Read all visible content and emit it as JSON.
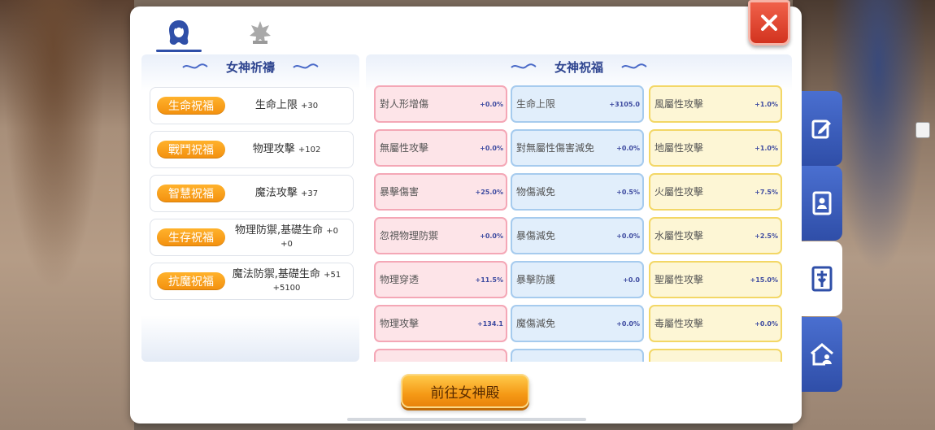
{
  "tabs": [
    {
      "icon": "goddess-head-icon",
      "active": true
    },
    {
      "icon": "crystal-emblem-icon",
      "active": false
    }
  ],
  "left": {
    "header": "女神祈禱",
    "items": [
      {
        "badge": "生命祝福",
        "text": "生命上限",
        "value": "+30"
      },
      {
        "badge": "戰鬥祝福",
        "text": "物理攻擊",
        "value": "+102"
      },
      {
        "badge": "智慧祝福",
        "text": "魔法攻擊",
        "value": "+37"
      },
      {
        "badge": "生存祝福",
        "text": "物理防禦,基礎生命",
        "value": "+0",
        "value2": "+0"
      },
      {
        "badge": "抗魔祝福",
        "text": "魔法防禦,基礎生命",
        "value": "+51",
        "value2": "+5100"
      }
    ]
  },
  "right": {
    "header": "女神祝福",
    "columns": [
      {
        "color": "pink",
        "items": [
          {
            "name": "對人形增傷",
            "value": "+0.0%"
          },
          {
            "name": "無屬性攻擊",
            "value": "+0.0%"
          },
          {
            "name": "暴擊傷害",
            "value": "+25.0%"
          },
          {
            "name": "忽視物理防禦",
            "value": "+0.0%"
          },
          {
            "name": "物理穿透",
            "value": "+11.5%"
          },
          {
            "name": "物理攻擊",
            "value": "+134.1"
          }
        ]
      },
      {
        "color": "blue",
        "items": [
          {
            "name": "生命上限",
            "value": "+3105.0"
          },
          {
            "name": "對無屬性傷害減免",
            "value": "+0.0%"
          },
          {
            "name": "物傷減免",
            "value": "+0.5%"
          },
          {
            "name": "暴傷減免",
            "value": "+0.0%"
          },
          {
            "name": "暴擊防護",
            "value": "+0.0"
          },
          {
            "name": "魔傷減免",
            "value": "+0.0%"
          }
        ]
      },
      {
        "color": "yellow",
        "items": [
          {
            "name": "風屬性攻擊",
            "value": "+1.0%"
          },
          {
            "name": "地屬性攻擊",
            "value": "+1.0%"
          },
          {
            "name": "火屬性攻擊",
            "value": "+7.5%"
          },
          {
            "name": "水屬性攻擊",
            "value": "+2.5%"
          },
          {
            "name": "聖屬性攻擊",
            "value": "+15.0%"
          },
          {
            "name": "毒屬性攻擊",
            "value": "+0.0%"
          }
        ]
      }
    ]
  },
  "button": {
    "label": "前往女神殿"
  },
  "side_tabs": [
    {
      "icon": "edit-note-icon",
      "active": false
    },
    {
      "icon": "contact-book-icon",
      "active": false
    },
    {
      "icon": "goddess-statue-icon",
      "active": true
    },
    {
      "icon": "guild-house-icon",
      "active": false
    }
  ],
  "colors": {
    "primary_blue": "#2f4590",
    "accent_orange": "#f59a16",
    "close_red": "#d2331f"
  }
}
